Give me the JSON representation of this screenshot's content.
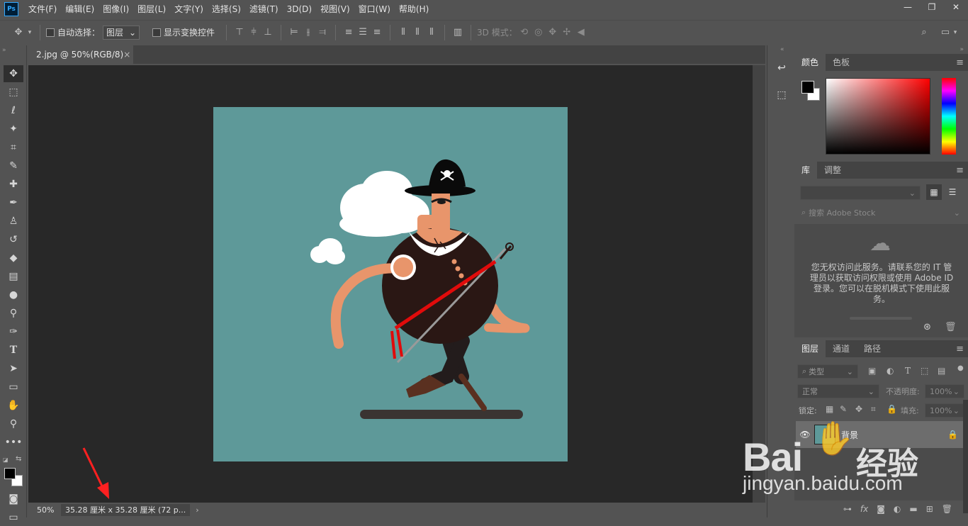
{
  "app": {
    "logo": "Ps"
  },
  "menu": [
    "文件(F)",
    "编辑(E)",
    "图像(I)",
    "图层(L)",
    "文字(Y)",
    "选择(S)",
    "滤镜(T)",
    "3D(D)",
    "视图(V)",
    "窗口(W)",
    "帮助(H)"
  ],
  "window_controls": {
    "minimize": "—",
    "restore": "❐",
    "close": "✕"
  },
  "options": {
    "auto_select_label": "自动选择：",
    "layer_select_value": "图层",
    "show_transform_label": "显示变换控件",
    "mode_3d_label": "3D 模式："
  },
  "document": {
    "tab_title": "2.jpg @ 50%(RGB/8)",
    "close": "×"
  },
  "status": {
    "zoom": "50%",
    "doc_size": "35.28 厘米 x 35.28 厘米 (72 p...",
    "arrow": "›"
  },
  "panels": {
    "color": {
      "tabs": [
        "颜色",
        "色板"
      ]
    },
    "library": {
      "tabs": [
        "库",
        "调整"
      ],
      "search_placeholder": "搜索 Adobe Stock",
      "message": "您无权访问此服务。请联系您的 IT 管理员以获取访问权限或使用 Adobe ID 登录。您可以在脱机模式下使用此服务。"
    },
    "layers": {
      "tabs": [
        "图层",
        "通道",
        "路径"
      ],
      "filter_kind": "类型",
      "blend_mode": "正常",
      "opacity_label": "不透明度:",
      "opacity_value": "100%",
      "lock_label": "锁定:",
      "fill_label": "填充:",
      "fill_value": "100%",
      "layer_name": "背景"
    }
  },
  "watermark": {
    "brand": "Bai",
    "brand_cn": "经验",
    "url": "jingyan.baidu.com"
  },
  "colors": {
    "accent": "#31a8ff",
    "canvas_bg": "#5e9999",
    "annotation_arrow": "#ff2020"
  }
}
